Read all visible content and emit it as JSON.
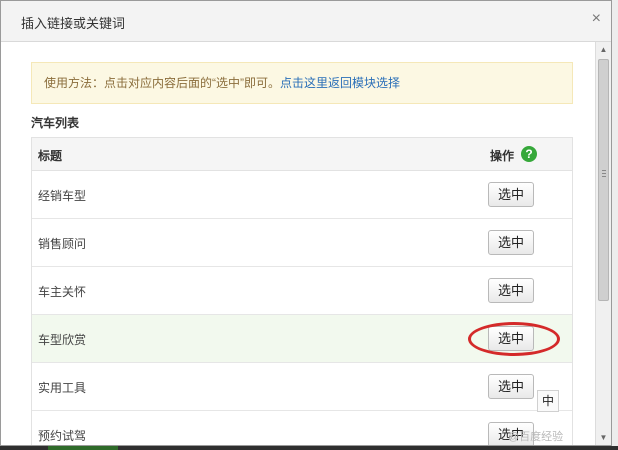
{
  "dialog": {
    "title": "插入链接或关键词",
    "close_glyph": "×"
  },
  "notice": {
    "text": "使用方法：点击对应内容后面的“选中”即可。",
    "link": "点击这里返回模块选择"
  },
  "list": {
    "title": "汽车列表",
    "header_title": "标题",
    "header_action": "操作",
    "help_glyph": "?",
    "rows": [
      {
        "label": "经销车型",
        "button": "选中"
      },
      {
        "label": "销售顾问",
        "button": "选中"
      },
      {
        "label": "车主关怀",
        "button": "选中"
      },
      {
        "label": "车型欣赏",
        "button": "选中"
      },
      {
        "label": "实用工具",
        "button": "选中"
      },
      {
        "label": "预约试驾",
        "button": "选中"
      }
    ]
  },
  "overlay": {
    "stray_text": "中",
    "watermark": "@百度经验"
  },
  "scrollbar": {
    "up_glyph": "▲",
    "down_glyph": "▼"
  },
  "colors": {
    "annotation_circle": "#d42a2a",
    "help_icon": "#36a83a",
    "notice_bg": "#fcf8e3",
    "link": "#2a6fb8"
  },
  "icons": [
    "close-icon",
    "help-icon",
    "scroll-up-icon",
    "scroll-down-icon"
  ]
}
